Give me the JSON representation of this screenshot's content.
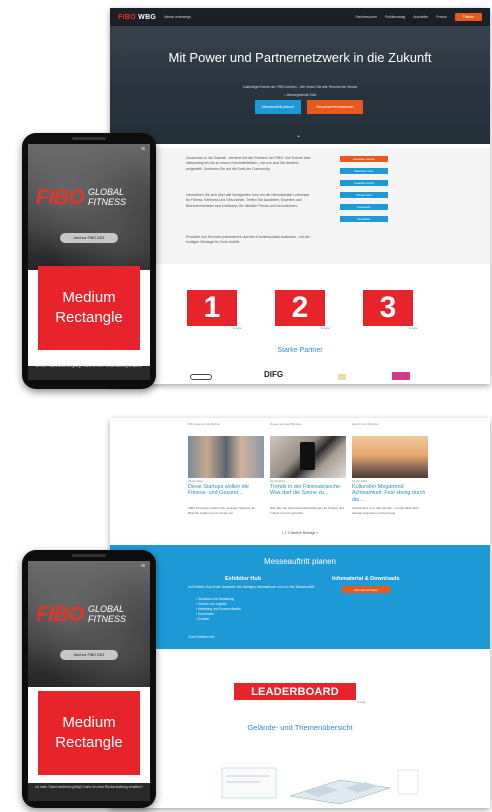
{
  "desktop1": {
    "logo": "FIBO",
    "logo_suffix": "WBG",
    "nav_left": "Messe unterwegs",
    "nav_items": [
      "Fachbesucher",
      "Publikumstag",
      "Aussteller",
      "Presse"
    ],
    "nav_button": "Tickets",
    "hero_title": "Mit Power und Partnernetzwerk in die Zukunft",
    "hero_sub": "Zukünftige Events der FIBO erleben - hier finden Sie alle Termine der Messe",
    "hero_location": "Messegelände Köln",
    "hero_btn1": "Messeauftritt planen",
    "hero_btn2": "Besucherinformationen",
    "intro_p1": "Zusammen in die Zukunft - vernetzt mit den Partnern der FIBO. Von Events über Networking bis hin zu neuen Geschäftsfeldern - mit uns sind Sie bestens aufgestellt. Vertrauen Sie auf die Kraft der Community.",
    "intro_p2": "Informieren Sie sich über alle Neuigkeiten rund um die internationale Leitmesse für Fitness, Wellness und Gesundheit. Treffen Sie Aussteller, Experten und Branchenvertreter und entdecken Sie aktuelle Trends und Innovationen.",
    "intro_p3": "Produkte und Services präsentieren und den Kundenkontakt ausbauen - mit der richtigen Strategie für Ihren Auftritt.",
    "side_buttons": [
      "Aussteller werden",
      "Besucher Infos",
      "Aussteller FAQs",
      "Presse Infos",
      "Livestream",
      "Newsletter"
    ],
    "ads": [
      "1",
      "2",
      "3"
    ],
    "ad_tag": "anzeige",
    "partners_title": "Starke Partner",
    "partner_logos": [
      "DIFG"
    ]
  },
  "desktop2": {
    "cards": [
      {
        "top": "Mit Lucas auf die Bühne",
        "date": "28.04.2021",
        "title": "Diese Startups wollen die Fitness- und Gesund...",
        "text": "FIBO Innovation Award: Die neuesten Startups der Branche stellen ihre Konzepte vor."
      },
      {
        "top": "Neues aus der Branche",
        "date": "21.04.2021",
        "title": "Trends in der Fitnessbranche: Was darf die Szene zu...",
        "text": "Das Jahr hat spannende Entwicklungen für Studios und Trainer mit sich gebracht."
      },
      {
        "top": "Events und Termine",
        "date": "14.04.2021",
        "title": "Kultureller Megatrend Achtsamkeit: Fest Honig durch die...",
        "text": "Achtsamkeit ist in aller Munde - ein Überblick über aktuelle Angebote und Konzepte."
      }
    ],
    "pager": "1  2  3  Weitere Beiträge  »",
    "plan_title": "Messeauftritt planen",
    "hub_title": "Exhibitor Hub",
    "hub_text": "Im Exhibitor Hub finden Aussteller alle wichtigen Informationen rund um den Messeauftritt.",
    "hub_list": [
      "Standbau und Gestaltung",
      "Service und Logistik",
      "Marketing und Kommunikation",
      "Downloads",
      "Kontakt"
    ],
    "hub_link": "Zum Exhibitor Hub",
    "info_title": "Infomaterial & Downloads",
    "info_button": "Infomaterial laden",
    "leaderboard": "LEADERBOARD",
    "leaderboard_tag": "anzeige",
    "overview_title": "Gelände- und Themenübersicht"
  },
  "phone": {
    "logo": "FIBO",
    "logo_global": "GLOBAL",
    "logo_fitness": "FITNESS",
    "button": "Jetzt zur FIBO 2021",
    "ad_label_line1": "Medium",
    "ad_label_line2": "Rectangle",
    "ticket_text": "Ist mein Ticket weiterhin gültig? Kann ich eine Rückerstattung erhalten?"
  },
  "colors": {
    "fibo_red": "#e5332a",
    "ad_red": "#e7242b",
    "brand_blue": "#1d9ad6",
    "accent_orange": "#e85a1b",
    "hero_dark": "#2a3440"
  }
}
